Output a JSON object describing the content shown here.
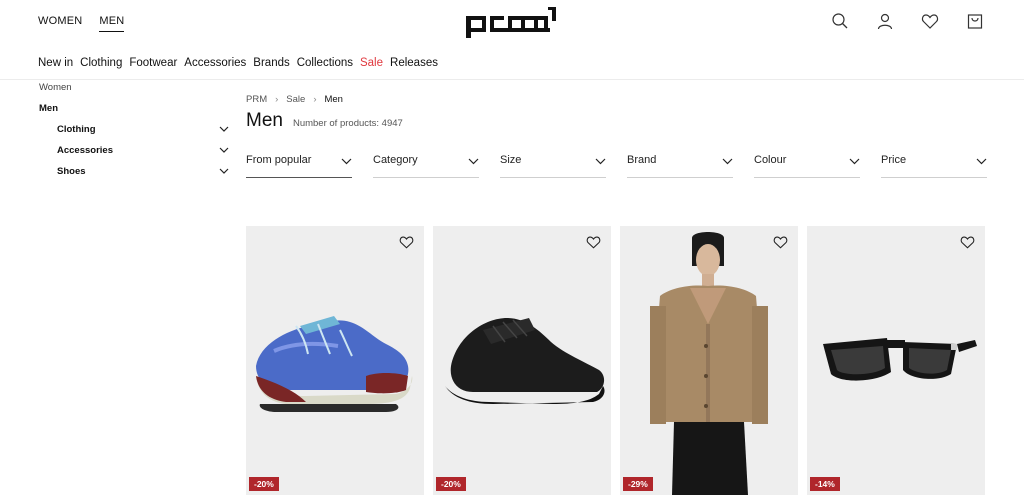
{
  "header": {
    "gender_tabs": [
      {
        "label": "WOMEN",
        "active": false
      },
      {
        "label": "MEN",
        "active": true
      }
    ],
    "logo_text": "prm",
    "icons": [
      "search-icon",
      "account-icon",
      "wishlist-icon",
      "cart-icon"
    ]
  },
  "nav": {
    "items": [
      {
        "label": "New in"
      },
      {
        "label": "Clothing"
      },
      {
        "label": "Footwear"
      },
      {
        "label": "Accessories"
      },
      {
        "label": "Brands"
      },
      {
        "label": "Collections"
      },
      {
        "label": "Sale",
        "color": "#e0383e"
      },
      {
        "label": "Releases"
      }
    ]
  },
  "sidebar": {
    "women": "Women",
    "men": "Men",
    "categories": [
      {
        "label": "Clothing"
      },
      {
        "label": "Accessories"
      },
      {
        "label": "Shoes"
      }
    ]
  },
  "breadcrumb": {
    "items": [
      "PRM",
      "Sale",
      "Men"
    ]
  },
  "page": {
    "title": "Men",
    "product_count": "Number of products: 4947"
  },
  "filters": [
    {
      "label": "From popular",
      "active": true
    },
    {
      "label": "Category"
    },
    {
      "label": "Size"
    },
    {
      "label": "Brand"
    },
    {
      "label": "Colour"
    },
    {
      "label": "Price"
    }
  ],
  "products": [
    {
      "discount": "-20%",
      "image": "salomon-sneaker"
    },
    {
      "discount": "-20%",
      "image": "black-sneaker"
    },
    {
      "discount": "-29%",
      "image": "model-in-beige-jacket"
    },
    {
      "discount": "-14%",
      "image": "black-sunglasses"
    }
  ],
  "colors": {
    "sale": "#e0383e",
    "discount_badge": "#b0262b",
    "card_bg": "#eeeeee"
  }
}
